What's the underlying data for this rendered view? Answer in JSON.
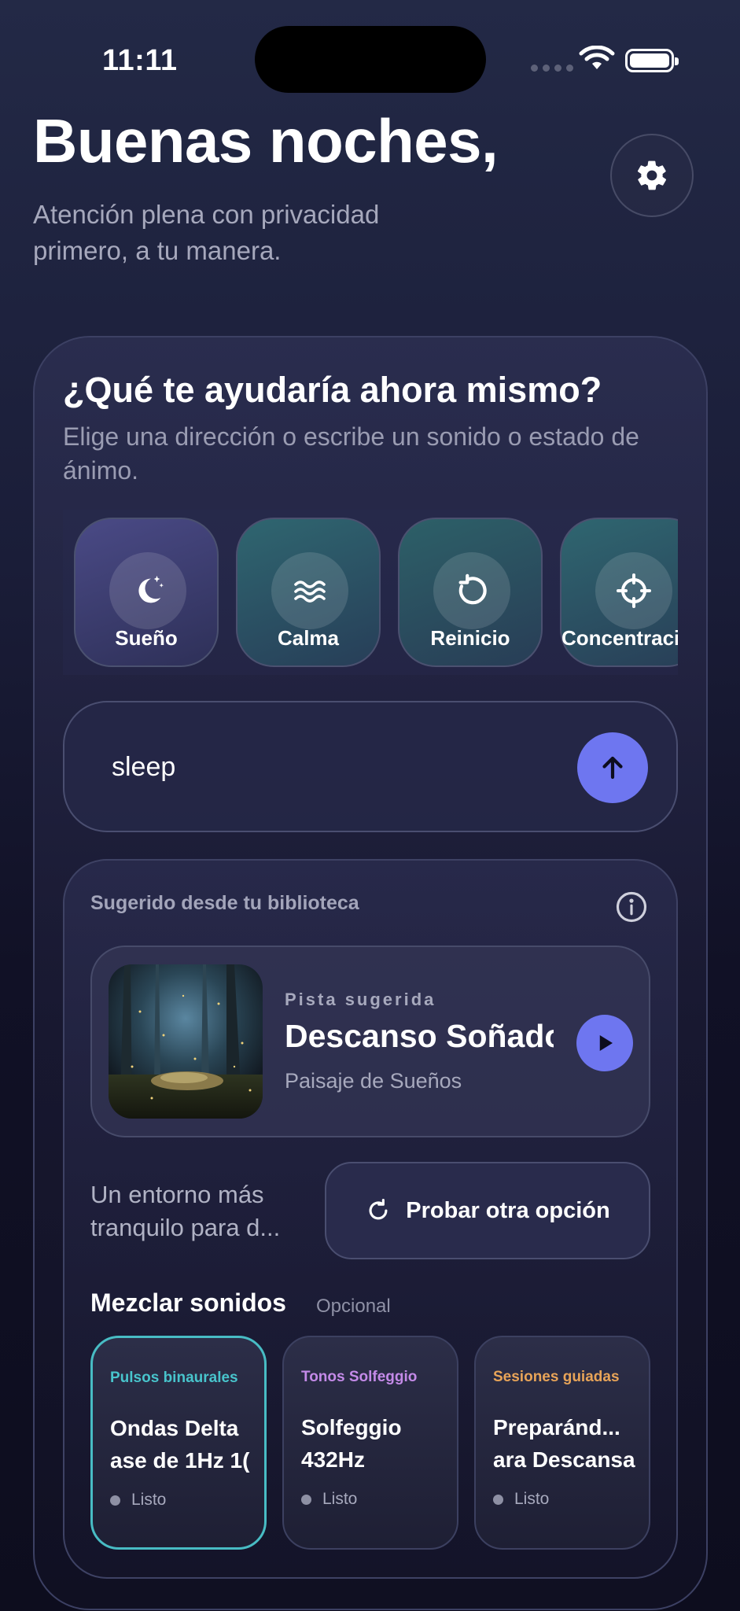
{
  "status": {
    "time": "11:11"
  },
  "header": {
    "greeting": "Buenas noches,",
    "tagline": "Atención plena con privacidad primero, a tu manera."
  },
  "prompt": {
    "question": "¿Qué te ayudaría ahora mismo?",
    "instruction": "Elige una dirección o escribe un sonido o estado de ánimo."
  },
  "moods": [
    {
      "label": "Sueño",
      "icon": "moon-stars-icon"
    },
    {
      "label": "Calma",
      "icon": "waves-icon"
    },
    {
      "label": "Reinicio",
      "icon": "reset-icon"
    },
    {
      "label": "Concentraci",
      "icon": "crosshair-icon"
    }
  ],
  "search": {
    "value": "sleep"
  },
  "suggestion": {
    "header": "Sugerido desde tu biblioteca",
    "track": {
      "kicker": "Pista sugerida",
      "title": "Descanso Soñado",
      "artist": "Paisaje de Sueños"
    },
    "environment_text": "Un entorno más tranquilo para d...",
    "retry_label": "Probar otra opción"
  },
  "mix": {
    "title": "Mezclar sonidos",
    "optional": "Opcional",
    "cards": [
      {
        "category": "Pulsos binaurales",
        "name_line1": "Ondas Delta",
        "name_line2": "ase de 1Hz 1(",
        "status": "Listo",
        "color": "#48c4cc"
      },
      {
        "category": "Tonos Solfeggio",
        "name_line1": "Solfeggio",
        "name_line2": "432Hz",
        "status": "Listo",
        "color": "#c48ae8"
      },
      {
        "category": "Sesiones guiadas",
        "name_line1": "Preparánd...",
        "name_line2": "ara Descansa",
        "status": "Listo",
        "color": "#e8a458"
      }
    ]
  },
  "colors": {
    "accent": "#6e76f0",
    "selected_border": "#48bcc4"
  }
}
